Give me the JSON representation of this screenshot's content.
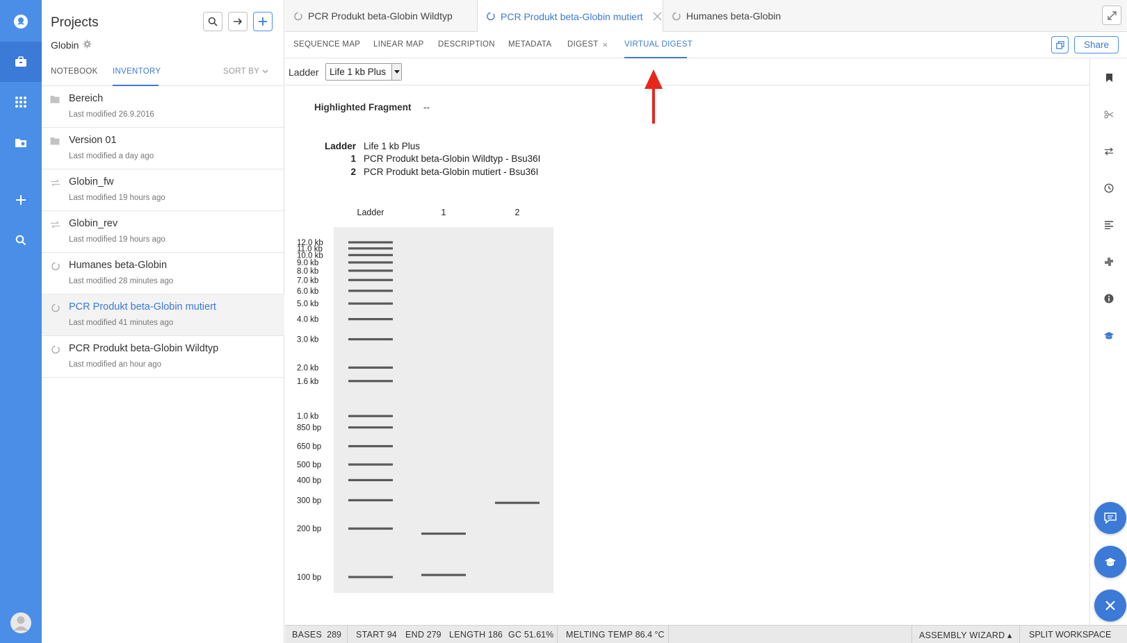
{
  "sidebar": {
    "title": "Projects",
    "project_name": "Globin",
    "tabs": [
      {
        "label": "NOTEBOOK"
      },
      {
        "label": "INVENTORY"
      }
    ],
    "sort_label": "SORT BY",
    "items": [
      {
        "name": "Bereich",
        "modified": "Last modified 26.9.2016",
        "icon": "folder-icon"
      },
      {
        "name": "Version 01",
        "modified": "Last modified a day ago",
        "icon": "folder-icon"
      },
      {
        "name": "Globin_fw",
        "modified": "Last modified 19 hours ago",
        "icon": "primer-icon"
      },
      {
        "name": "Globin_rev",
        "modified": "Last modified 19 hours ago",
        "icon": "primer-icon"
      },
      {
        "name": "Humanes beta-Globin",
        "modified": "Last modified 28 minutes ago",
        "icon": "circular-dna-icon"
      },
      {
        "name": "PCR Produkt beta-Globin mutiert",
        "modified": "Last modified 41 minutes ago",
        "icon": "circular-dna-icon"
      },
      {
        "name": "PCR Produkt beta-Globin Wildtyp",
        "modified": "Last modified an hour ago",
        "icon": "circular-dna-icon"
      }
    ]
  },
  "tabs": [
    {
      "label": "PCR Produkt beta-Globin Wildtyp"
    },
    {
      "label": "PCR Produkt beta-Globin mutiert"
    },
    {
      "label": "Humanes beta-Globin"
    }
  ],
  "view_tabs": [
    {
      "label": "SEQUENCE MAP"
    },
    {
      "label": "LINEAR MAP"
    },
    {
      "label": "DESCRIPTION"
    },
    {
      "label": "METADATA"
    },
    {
      "label": "DIGEST"
    },
    {
      "label": "VIRTUAL DIGEST"
    }
  ],
  "share_label": "Share",
  "ladder_bar": {
    "label": "Ladder",
    "selected": "Life 1 kb Plus"
  },
  "digest": {
    "highlighted_label": "Highlighted Fragment",
    "highlighted_value": "--",
    "legend": [
      {
        "key": "Ladder",
        "value": "Life 1 kb Plus"
      },
      {
        "key": "1",
        "value": "PCR Produkt beta-Globin Wildtyp - Bsu36I"
      },
      {
        "key": "2",
        "value": "PCR Produkt beta-Globin mutiert - Bsu36I"
      }
    ]
  },
  "chart_data": {
    "type": "gel",
    "lane_labels": [
      "Ladder",
      "1",
      "2"
    ],
    "ladder": [
      {
        "label": "12.0 kb",
        "bp": 12000
      },
      {
        "label": "11.0 kb",
        "bp": 11000
      },
      {
        "label": "10.0 kb",
        "bp": 10000
      },
      {
        "label": "9.0 kb",
        "bp": 9000
      },
      {
        "label": "8.0 kb",
        "bp": 8000
      },
      {
        "label": "7.0 kb",
        "bp": 7000
      },
      {
        "label": "6.0 kb",
        "bp": 6000
      },
      {
        "label": "5.0 kb",
        "bp": 5000
      },
      {
        "label": "4.0 kb",
        "bp": 4000
      },
      {
        "label": "3.0 kb",
        "bp": 3000
      },
      {
        "label": "2.0 kb",
        "bp": 2000
      },
      {
        "label": "1.6 kb",
        "bp": 1650
      },
      {
        "label": "1.0 kb",
        "bp": 1000
      },
      {
        "label": "850 bp",
        "bp": 850
      },
      {
        "label": "650 bp",
        "bp": 650
      },
      {
        "label": "500 bp",
        "bp": 500
      },
      {
        "label": "400 bp",
        "bp": 400
      },
      {
        "label": "300 bp",
        "bp": 300
      },
      {
        "label": "200 bp",
        "bp": 200
      },
      {
        "label": "100 bp",
        "bp": 100
      }
    ],
    "lanes": [
      {
        "name": "1",
        "bands_bp": [
          186,
          103
        ]
      },
      {
        "name": "2",
        "bands_bp": [
          289
        ]
      }
    ]
  },
  "status": {
    "bases_label": "BASES",
    "bases": "289",
    "start_label": "START",
    "start": "94",
    "end_label": "END",
    "end": "279",
    "length_label": "LENGTH",
    "length": "186",
    "gc_label": "GC",
    "gc": "51.61%",
    "melting_label": "MELTING TEMP",
    "melting": "86.4 °C",
    "assembly": "ASSEMBLY WIZARD",
    "split": "SPLIT WORKSPACE"
  },
  "colors": {
    "accent": "#3b7ad6",
    "rail": "#4a8ee8",
    "arrow": "#e8261c",
    "band": "#5a5a5a",
    "gel": "#ededed"
  }
}
